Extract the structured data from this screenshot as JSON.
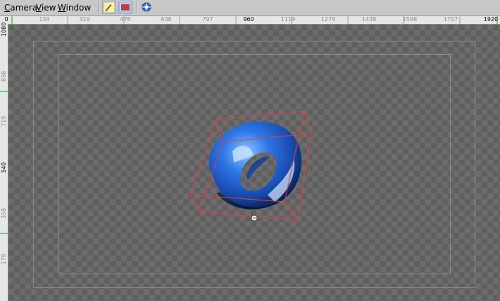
{
  "menu": {
    "camera": {
      "first": "C",
      "rest": "amera"
    },
    "view": {
      "first": "V",
      "rest": "iew"
    },
    "window": {
      "first": "W",
      "rest": "indow"
    }
  },
  "toolbar": [
    {
      "icon": "wand-icon",
      "pressed": true
    },
    {
      "icon": "render-icon",
      "pressed": true
    },
    {
      "icon": "snap-icon",
      "pressed": false
    }
  ],
  "ruler_top": {
    "labels": [
      "0",
      "159",
      "319",
      "478",
      "638",
      "797",
      "960",
      "1119",
      "1279",
      "1438",
      "1598",
      "1757",
      "1920"
    ]
  },
  "ruler_left": {
    "labels": [
      "1080",
      "898",
      "719",
      "540",
      "358",
      "179"
    ]
  },
  "colors": {
    "bounding_box": "#e04040",
    "torus": "#1a5ad0",
    "guide": "#8a8a8a"
  }
}
